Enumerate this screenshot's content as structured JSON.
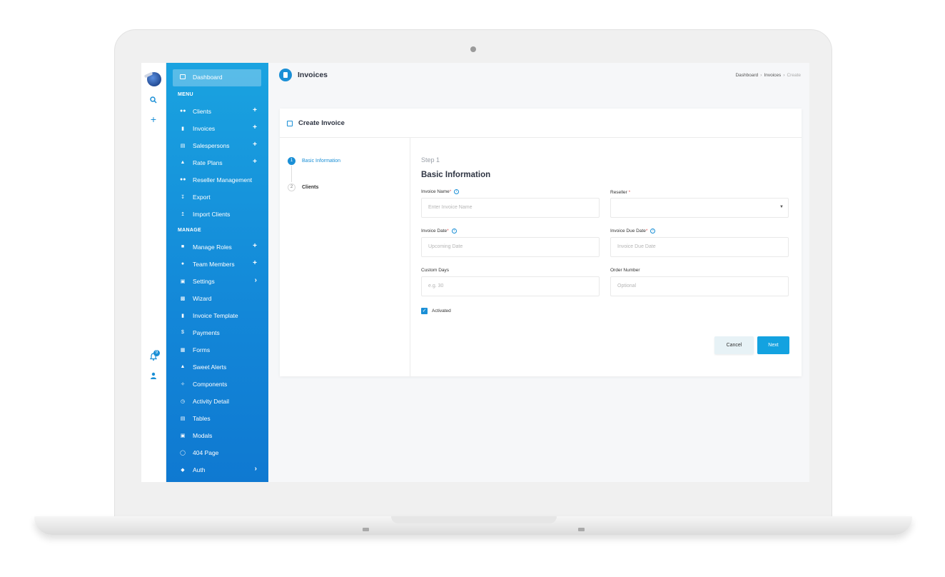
{
  "page": {
    "title": "Invoices"
  },
  "breadcrumb": [
    "Dashboard",
    "Invoices",
    "Create"
  ],
  "iconbar": {
    "notification_count": "9"
  },
  "sidebar": {
    "dashboard_label": "Dashboard",
    "menu_section": "MENU",
    "menu_items": [
      {
        "label": "Clients",
        "action": "+"
      },
      {
        "label": "Invoices",
        "action": "+"
      },
      {
        "label": "Salespersons",
        "action": "+"
      },
      {
        "label": "Rate Plans",
        "action": "+"
      },
      {
        "label": "Reseller Management",
        "action": ""
      },
      {
        "label": "Export",
        "action": ""
      },
      {
        "label": "Import Clients",
        "action": ""
      }
    ],
    "manage_section": "MANAGE",
    "manage_items": [
      {
        "label": "Manage Roles",
        "action": "+"
      },
      {
        "label": "Team Members",
        "action": "+"
      },
      {
        "label": "Settings",
        "action": "›"
      },
      {
        "label": "Wizard",
        "action": ""
      },
      {
        "label": "Invoice Template",
        "action": ""
      },
      {
        "label": "Payments",
        "action": ""
      },
      {
        "label": "Forms",
        "action": ""
      },
      {
        "label": "Sweet Alerts",
        "action": ""
      },
      {
        "label": "Components",
        "action": ""
      },
      {
        "label": "Activity Detail",
        "action": ""
      },
      {
        "label": "Tables",
        "action": ""
      },
      {
        "label": "Modals",
        "action": ""
      },
      {
        "label": "404 Page",
        "action": ""
      },
      {
        "label": "Auth",
        "action": "›"
      }
    ]
  },
  "card": {
    "title": "Create Invoice",
    "steps": [
      {
        "number": "1",
        "label": "Basic Information"
      },
      {
        "number": "2",
        "label": "Clients"
      }
    ],
    "step_label": "Step 1",
    "form_title": "Basic Information",
    "fields": {
      "invoice_name": {
        "label": "Invoice Name",
        "placeholder": "Enter Invoice Name"
      },
      "reseller": {
        "label": "Reseller",
        "value": ""
      },
      "invoice_date": {
        "label": "Invoice Date",
        "placeholder": "Upcoming Date"
      },
      "invoice_due_date": {
        "label": "Invoice Due Date",
        "placeholder": "Invoice Due Date"
      },
      "custom_days": {
        "label": "Custom Days",
        "placeholder": "e.g. 30"
      },
      "order_number": {
        "label": "Order Number",
        "placeholder": "Optional"
      }
    },
    "activated": {
      "label": "Activated",
      "checked": true
    },
    "cancel_label": "Cancel",
    "next_label": "Next"
  },
  "colors": {
    "accent": "#1a8fd6",
    "sidebar_top": "#1aa3e0",
    "sidebar_bottom": "#0f79d1"
  }
}
